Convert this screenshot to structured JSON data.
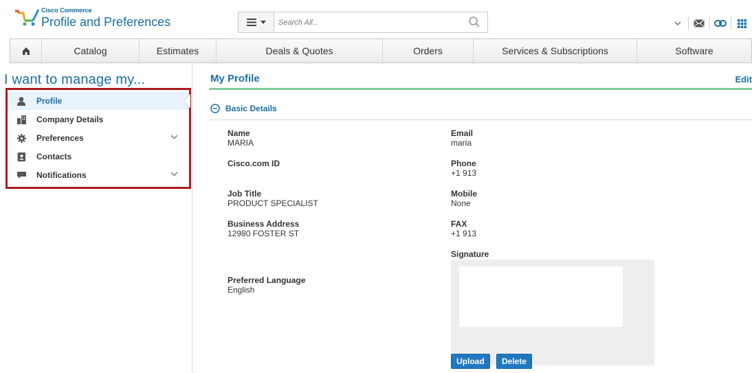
{
  "header": {
    "brand_small": "Cisco Commerce",
    "title": "Profile and Preferences",
    "search_placeholder": "Search All...",
    "icons": [
      "chevron-down-icon",
      "mail-icon",
      "link-icon",
      "grid-icon"
    ]
  },
  "nav": {
    "home_icon": "home-icon",
    "items": [
      "Catalog",
      "Estimates",
      "Deals & Quotes",
      "Orders",
      "Services & Subscriptions",
      "Software"
    ]
  },
  "left": {
    "title": "I want to manage my...",
    "menu": [
      {
        "label": "Profile",
        "icon": "person-icon",
        "active": true
      },
      {
        "label": "Company Details",
        "icon": "building-icon"
      },
      {
        "label": "Preferences",
        "icon": "gear-icon",
        "expandable": true
      },
      {
        "label": "Contacts",
        "icon": "contacts-icon"
      },
      {
        "label": "Notifications",
        "icon": "chat-icon",
        "expandable": true
      }
    ]
  },
  "main": {
    "title": "My Profile",
    "edit_label": "Edit",
    "section_label": "Basic Details",
    "fields": {
      "name": {
        "label": "Name",
        "value": "MARIA"
      },
      "cisco_id": {
        "label": "Cisco.com ID",
        "value": ""
      },
      "job_title": {
        "label": "Job Title",
        "value": "PRODUCT SPECIALIST"
      },
      "business_address": {
        "label": "Business Address",
        "value": "12980 FOSTER ST"
      },
      "preferred_language": {
        "label": "Preferred Language",
        "value": "English"
      },
      "email": {
        "label": "Email",
        "value": "maria"
      },
      "phone": {
        "label": "Phone",
        "value": "+1 913"
      },
      "mobile": {
        "label": "Mobile",
        "value": "None"
      },
      "fax": {
        "label": "FAX",
        "value": "+1 913"
      }
    },
    "signature_label": "Signature",
    "upload_label": "Upload",
    "delete_label": "Delete"
  },
  "colors": {
    "accent": "#1a6fa6",
    "highlight_border": "#b1181d",
    "green_rule": "#7fc99a",
    "button": "#1f78c1"
  }
}
